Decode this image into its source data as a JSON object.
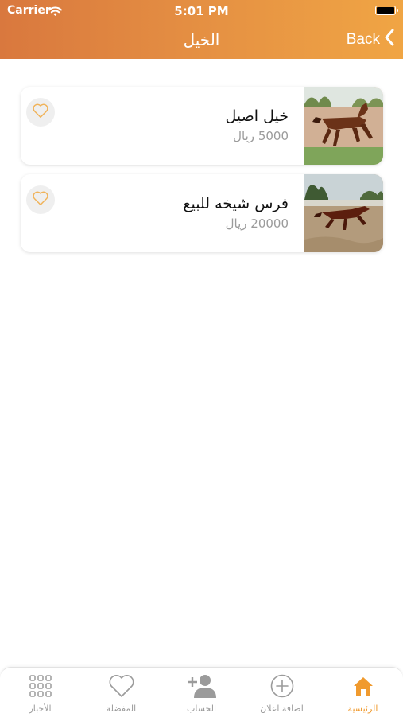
{
  "status_bar": {
    "carrier": "Carrier",
    "time": "5:01 PM"
  },
  "nav": {
    "title": "الخيل",
    "back_label": "Back"
  },
  "listings": [
    {
      "title": "خيل اصيل",
      "price": "5000 ريال"
    },
    {
      "title": "فرس شيخه للبيع",
      "price": "20000 ريال"
    }
  ],
  "tabs": [
    {
      "label": "الرئيسية",
      "icon": "home-icon",
      "active": true
    },
    {
      "label": "اضافة اعلان",
      "icon": "plus-circle-icon",
      "active": false
    },
    {
      "label": "الحساب",
      "icon": "add-user-icon",
      "active": false
    },
    {
      "label": "المفضلة",
      "icon": "heart-icon",
      "active": false
    },
    {
      "label": "الأخبار",
      "icon": "grid-icon",
      "active": false
    }
  ],
  "colors": {
    "header_start": "#d9783e",
    "header_end": "#f0a544",
    "accent": "#f09a2e",
    "inactive": "#9b9b9b"
  }
}
